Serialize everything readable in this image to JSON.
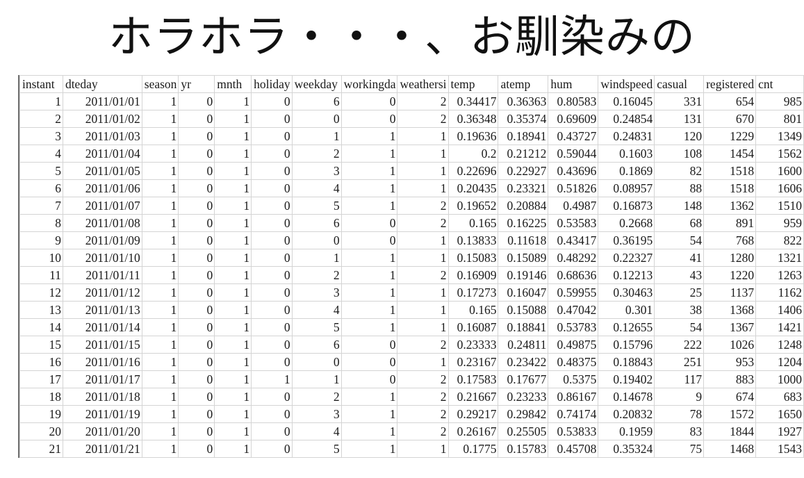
{
  "slide": {
    "title": "ホラホラ・・・、お馴染みの"
  },
  "sheet": {
    "columns": [
      "instant",
      "dteday",
      "season",
      "yr",
      "mnth",
      "holiday",
      "weekday",
      "workingda",
      "weathersi",
      "temp",
      "atemp",
      "hum",
      "windspeed",
      "casual",
      "registered",
      "cnt"
    ],
    "rows": [
      [
        "1",
        "2011/01/01",
        "1",
        "0",
        "1",
        "0",
        "6",
        "0",
        "2",
        "0.34417",
        "0.36363",
        "0.80583",
        "0.16045",
        "331",
        "654",
        "985"
      ],
      [
        "2",
        "2011/01/02",
        "1",
        "0",
        "1",
        "0",
        "0",
        "0",
        "2",
        "0.36348",
        "0.35374",
        "0.69609",
        "0.24854",
        "131",
        "670",
        "801"
      ],
      [
        "3",
        "2011/01/03",
        "1",
        "0",
        "1",
        "0",
        "1",
        "1",
        "1",
        "0.19636",
        "0.18941",
        "0.43727",
        "0.24831",
        "120",
        "1229",
        "1349"
      ],
      [
        "4",
        "2011/01/04",
        "1",
        "0",
        "1",
        "0",
        "2",
        "1",
        "1",
        "0.2",
        "0.21212",
        "0.59044",
        "0.1603",
        "108",
        "1454",
        "1562"
      ],
      [
        "5",
        "2011/01/05",
        "1",
        "0",
        "1",
        "0",
        "3",
        "1",
        "1",
        "0.22696",
        "0.22927",
        "0.43696",
        "0.1869",
        "82",
        "1518",
        "1600"
      ],
      [
        "6",
        "2011/01/06",
        "1",
        "0",
        "1",
        "0",
        "4",
        "1",
        "1",
        "0.20435",
        "0.23321",
        "0.51826",
        "0.08957",
        "88",
        "1518",
        "1606"
      ],
      [
        "7",
        "2011/01/07",
        "1",
        "0",
        "1",
        "0",
        "5",
        "1",
        "2",
        "0.19652",
        "0.20884",
        "0.4987",
        "0.16873",
        "148",
        "1362",
        "1510"
      ],
      [
        "8",
        "2011/01/08",
        "1",
        "0",
        "1",
        "0",
        "6",
        "0",
        "2",
        "0.165",
        "0.16225",
        "0.53583",
        "0.2668",
        "68",
        "891",
        "959"
      ],
      [
        "9",
        "2011/01/09",
        "1",
        "0",
        "1",
        "0",
        "0",
        "0",
        "1",
        "0.13833",
        "0.11618",
        "0.43417",
        "0.36195",
        "54",
        "768",
        "822"
      ],
      [
        "10",
        "2011/01/10",
        "1",
        "0",
        "1",
        "0",
        "1",
        "1",
        "1",
        "0.15083",
        "0.15089",
        "0.48292",
        "0.22327",
        "41",
        "1280",
        "1321"
      ],
      [
        "11",
        "2011/01/11",
        "1",
        "0",
        "1",
        "0",
        "2",
        "1",
        "2",
        "0.16909",
        "0.19146",
        "0.68636",
        "0.12213",
        "43",
        "1220",
        "1263"
      ],
      [
        "12",
        "2011/01/12",
        "1",
        "0",
        "1",
        "0",
        "3",
        "1",
        "1",
        "0.17273",
        "0.16047",
        "0.59955",
        "0.30463",
        "25",
        "1137",
        "1162"
      ],
      [
        "13",
        "2011/01/13",
        "1",
        "0",
        "1",
        "0",
        "4",
        "1",
        "1",
        "0.165",
        "0.15088",
        "0.47042",
        "0.301",
        "38",
        "1368",
        "1406"
      ],
      [
        "14",
        "2011/01/14",
        "1",
        "0",
        "1",
        "0",
        "5",
        "1",
        "1",
        "0.16087",
        "0.18841",
        "0.53783",
        "0.12655",
        "54",
        "1367",
        "1421"
      ],
      [
        "15",
        "2011/01/15",
        "1",
        "0",
        "1",
        "0",
        "6",
        "0",
        "2",
        "0.23333",
        "0.24811",
        "0.49875",
        "0.15796",
        "222",
        "1026",
        "1248"
      ],
      [
        "16",
        "2011/01/16",
        "1",
        "0",
        "1",
        "0",
        "0",
        "0",
        "1",
        "0.23167",
        "0.23422",
        "0.48375",
        "0.18843",
        "251",
        "953",
        "1204"
      ],
      [
        "17",
        "2011/01/17",
        "1",
        "0",
        "1",
        "1",
        "1",
        "0",
        "2",
        "0.17583",
        "0.17677",
        "0.5375",
        "0.19402",
        "117",
        "883",
        "1000"
      ],
      [
        "18",
        "2011/01/18",
        "1",
        "0",
        "1",
        "0",
        "2",
        "1",
        "2",
        "0.21667",
        "0.23233",
        "0.86167",
        "0.14678",
        "9",
        "674",
        "683"
      ],
      [
        "19",
        "2011/01/19",
        "1",
        "0",
        "1",
        "0",
        "3",
        "1",
        "2",
        "0.29217",
        "0.29842",
        "0.74174",
        "0.20832",
        "78",
        "1572",
        "1650"
      ],
      [
        "20",
        "2011/01/20",
        "1",
        "0",
        "1",
        "0",
        "4",
        "1",
        "2",
        "0.26167",
        "0.25505",
        "0.53833",
        "0.1959",
        "83",
        "1844",
        "1927"
      ],
      [
        "21",
        "2011/01/21",
        "1",
        "0",
        "1",
        "0",
        "5",
        "1",
        "1",
        "0.1775",
        "0.15783",
        "0.45708",
        "0.35324",
        "75",
        "1468",
        "1543"
      ]
    ]
  }
}
